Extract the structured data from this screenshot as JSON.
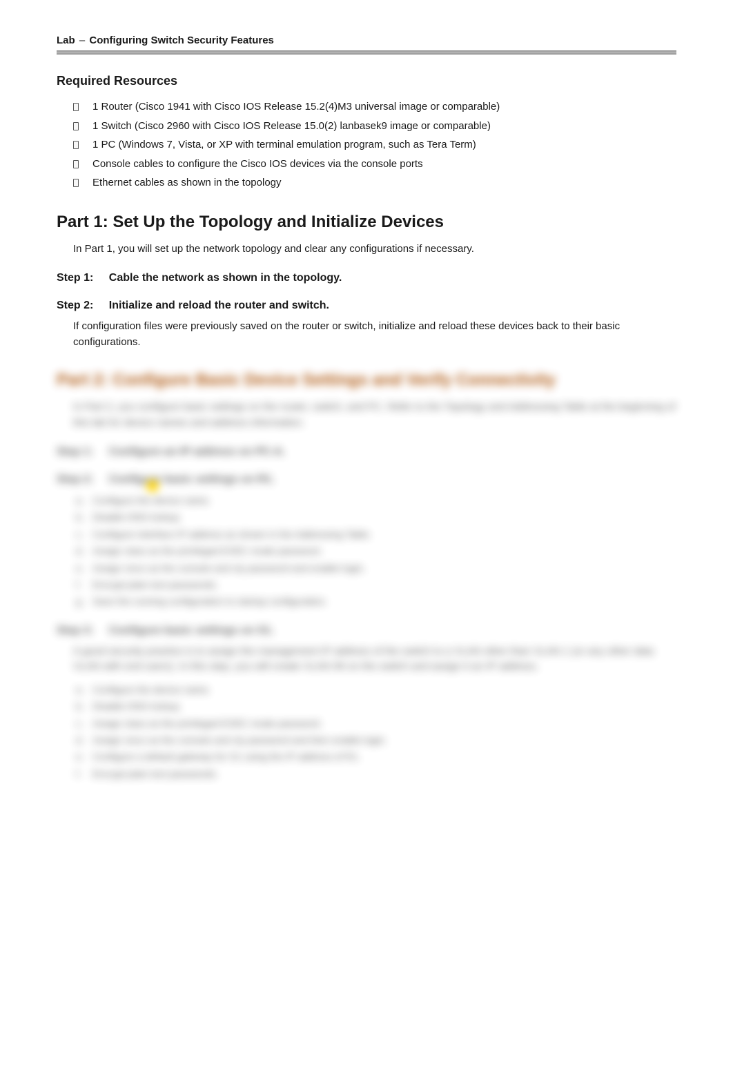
{
  "header": {
    "prefix": "Lab",
    "dash": "–",
    "title": "Configuring Switch Security Features"
  },
  "resources": {
    "heading": "Required Resources",
    "items": [
      "1 Router (Cisco 1941 with Cisco IOS Release 15.2(4)M3 universal image or comparable)",
      "1 Switch (Cisco 2960 with Cisco IOS Release 15.0(2) lanbasek9 image or comparable)",
      "1 PC (Windows 7, Vista, or XP with terminal emulation program, such as Tera Term)",
      "Console cables to configure the Cisco IOS devices via the console ports",
      "Ethernet cables as shown in the topology"
    ]
  },
  "part1": {
    "heading": "Part 1:  Set Up the Topology and Initialize Devices",
    "intro": "In Part 1, you will set up the network topology and clear any configurations if necessary.",
    "step1": {
      "num": "Step 1:",
      "text": "Cable the network as shown in the topology."
    },
    "step2": {
      "num": "Step 2:",
      "text": "Initialize and reload the router and switch.",
      "body": "If configuration files were previously saved on the router or switch, initialize and reload these devices back to their basic configurations."
    }
  },
  "part2": {
    "heading": "Part 2:  Configure Basic Device Settings and Verify Connectivity",
    "intro": "In Part 2, you configure basic settings on the router, switch, and PC. Refer to the Topology and Addressing Table at the beginning of this lab for device names and address information.",
    "step1": {
      "num": "Step 1:",
      "text": "Configure an IP address on PC-A."
    },
    "step2": {
      "num": "Step 2:",
      "text": "Configure basic settings on R1.",
      "items": [
        "Configure the device name.",
        "Disable DNS lookup.",
        "Configure interface IP address as shown in the Addressing Table.",
        "Assign class as the privileged EXEC mode password.",
        "Assign cisco as the console and vty password and enable login.",
        "Encrypt plain text passwords.",
        "Save the running configuration to startup configuration."
      ]
    },
    "step3": {
      "num": "Step 3:",
      "text": "Configure basic settings on S1.",
      "body": "A good security practice is to assign the management IP address of the switch to a VLAN other than VLAN 1 (or any other data VLAN with end users). In this step, you will create VLAN 99 on the switch and assign it an IP address.",
      "items": [
        "Configure the device name.",
        "Disable DNS lookup.",
        "Assign class as the privileged EXEC mode password.",
        "Assign cisco as the console and vty password and then enable login.",
        "Configure a default gateway for S1 using the IP address of R1.",
        "Encrypt plain text passwords."
      ]
    }
  }
}
